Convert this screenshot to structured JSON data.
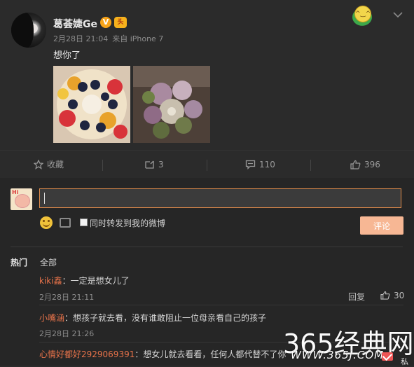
{
  "post": {
    "author": "葛荟婕Ge",
    "verified_mark": "V",
    "level_badge": "头",
    "timestamp": "2月28日 21:04",
    "source": "来自 iPhone 7",
    "text": "想你了",
    "images": [
      "fruit-cake-photo",
      "flower-bouquet-photo"
    ],
    "menu_icon": "chevron-down-icon"
  },
  "actions": {
    "favorite": "收藏",
    "repost_count": "3",
    "comment_count": "110",
    "like_count": "396"
  },
  "composer": {
    "input_value": "",
    "forward_label": "同时转发到我的微博",
    "submit_label": "评论"
  },
  "tabs": {
    "hot": "热门",
    "all": "全部"
  },
  "comments": [
    {
      "user": "kiki鑫",
      "text": "：一定是想女儿了",
      "time": "2月28日 21:11",
      "reply": "回复",
      "likes": "30"
    },
    {
      "user": "小嘴涵",
      "text": "：想孩子就去看，没有谁敢阻止一位母亲看自己的孩子",
      "time": "2月28日 21:26"
    },
    {
      "user": "心情好都好2929069391",
      "text": "：想女儿就去看看，任何人都代替不了你"
    }
  ],
  "watermark": {
    "brand": "365经典网",
    "url": "WWW.365J.COM"
  },
  "chat_bar": {
    "label": "私"
  },
  "colors": {
    "accent": "#e8734a",
    "background": "#2b2b2b",
    "submit": "#f7b794"
  }
}
